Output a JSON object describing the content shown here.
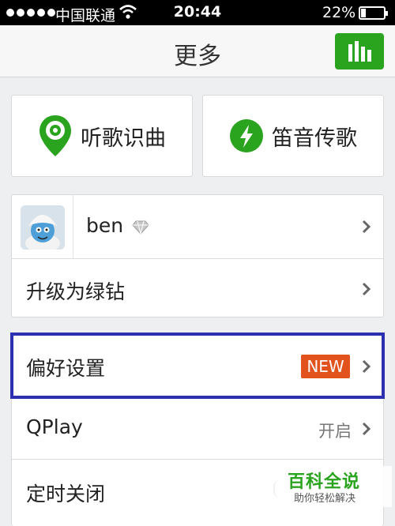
{
  "status_bar": {
    "carrier": "中国联通",
    "time": "20:44",
    "battery_percent_text": "22%",
    "battery_level": 0.22
  },
  "nav": {
    "title": "更多",
    "chart_icon": "bar-chart-icon",
    "accent": "#2aa31f"
  },
  "cards": [
    {
      "label": "听歌识曲",
      "icon": "location-pin-icon"
    },
    {
      "label": "笛音传歌",
      "icon": "lightning-icon"
    }
  ],
  "profile": {
    "username": "ben",
    "badge_icon": "diamond-icon",
    "upgrade_label": "升级为绿钻"
  },
  "settings": {
    "preferences_label": "偏好设置",
    "new_badge": "NEW",
    "new_badge_color": "#e2521d",
    "qplay_label": "QPlay",
    "qplay_status": "开启",
    "timer_label": "定时关闭"
  },
  "watermark": {
    "title": "百科全说",
    "subtitle": "助你轻松解决"
  }
}
